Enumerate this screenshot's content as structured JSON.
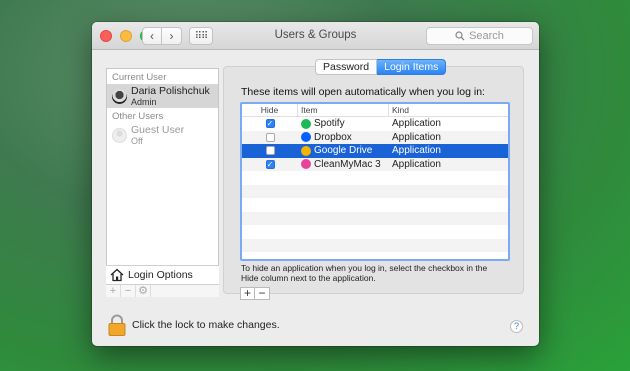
{
  "window": {
    "title": "Users & Groups"
  },
  "toolbar": {
    "back_icon": "‹",
    "forward_icon": "›",
    "grid_icon": "⠿⠿",
    "search_placeholder": "Search"
  },
  "sidebar": {
    "current_user_header": "Current User",
    "current_user": {
      "name": "Daria Polishchuk",
      "role": "Admin"
    },
    "other_users_header": "Other Users",
    "other_users": [
      {
        "name": "Guest User",
        "status": "Off"
      }
    ],
    "login_options_label": "Login Options",
    "tools": [
      "+",
      "−",
      "⚙"
    ]
  },
  "tabs": [
    {
      "label": "Password",
      "active": false
    },
    {
      "label": "Login Items",
      "active": true
    }
  ],
  "login_items": {
    "intro": "These items will open automatically when you log in:",
    "columns": {
      "hide": "Hide",
      "item": "Item",
      "kind": "Kind"
    },
    "rows": [
      {
        "hide": true,
        "name": "Spotify",
        "kind": "Application",
        "icon": "spotify-icon",
        "color": "#1db954"
      },
      {
        "hide": false,
        "name": "Dropbox",
        "kind": "Application",
        "icon": "dropbox-icon",
        "color": "#0061ff"
      },
      {
        "hide": false,
        "name": "Google Drive",
        "kind": "Application",
        "icon": "google-drive-icon",
        "color": "#f4b400",
        "selected": true
      },
      {
        "hide": true,
        "name": "CleanMyMac 3",
        "kind": "Application",
        "icon": "cleanmymac-icon",
        "color": "#e8459a"
      }
    ],
    "hint": "To hide an application when you log in, select the checkbox in the Hide column next to the application.",
    "add_label": "+",
    "remove_label": "−"
  },
  "footer": {
    "lock_text": "Click the lock to make changes.",
    "help_label": "?"
  },
  "colors": {
    "accent": "#2b82f5",
    "selection": "#1a63d6"
  }
}
